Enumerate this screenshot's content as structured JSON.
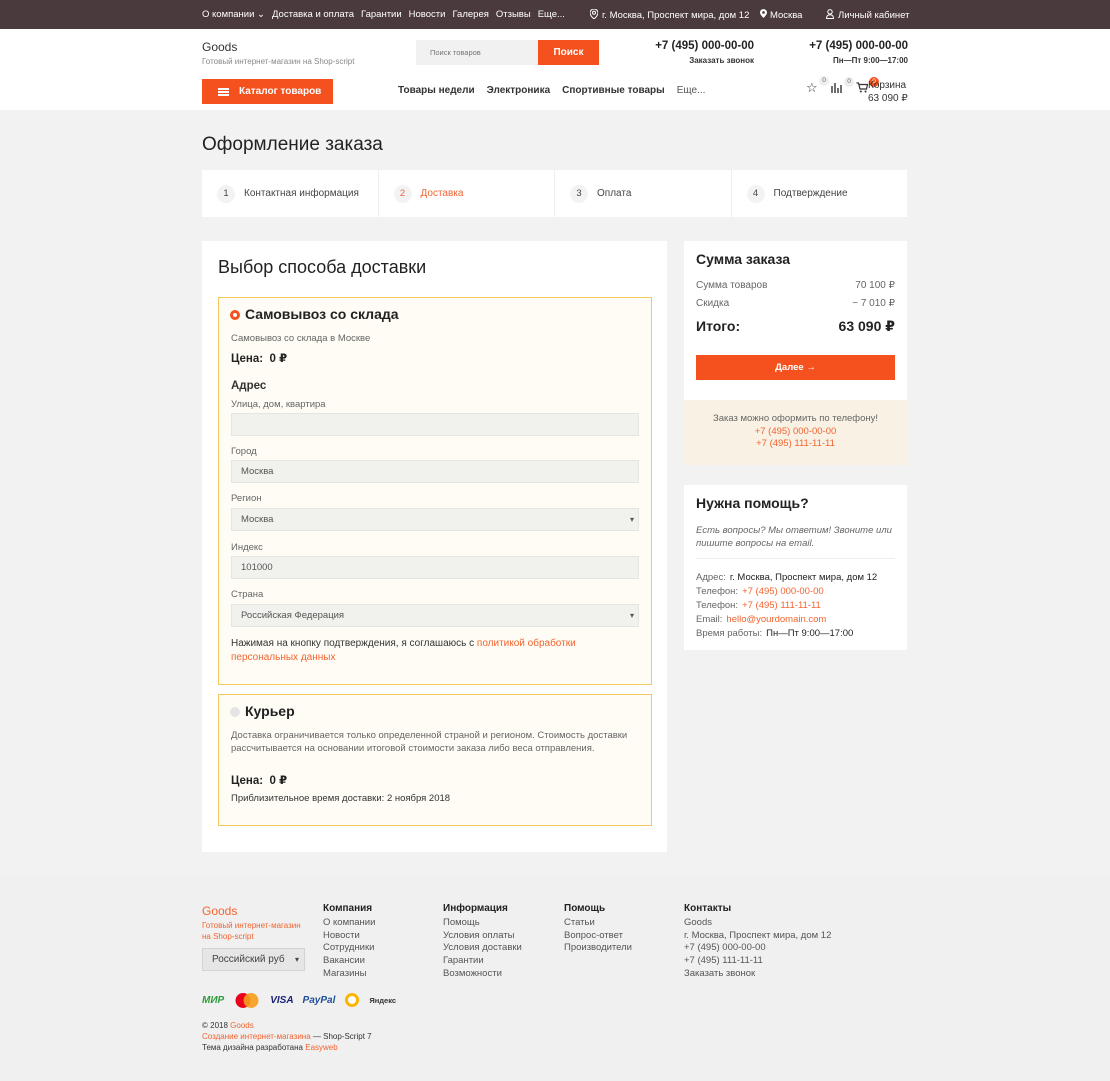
{
  "topbar": {
    "nav": [
      "О компании",
      "Доставка и оплата",
      "Гарантии",
      "Новости",
      "Галерея",
      "Отзывы",
      "Еще..."
    ],
    "address": "г. Москва, Проспект мира, дом 12",
    "city": "Москва",
    "cabinet": "Личный кабинет"
  },
  "header": {
    "logo": "Goods",
    "tagline": "Готовый интернет-магазин на Shop-script",
    "search_placeholder": "Поиск товаров",
    "search_button": "Поиск",
    "phone1": "+7 (495) 000-00-00",
    "phone1_sub": "Заказать звонок",
    "phone2": "+7 (495) 000-00-00",
    "phone2_sub": "Пн—Пт 9:00—17:00",
    "catalog_button": "Каталог товаров",
    "catnav": [
      "Товары недели",
      "Электроника",
      "Спортивные товары"
    ],
    "catnav_more": "Еще...",
    "favorites_count": "0",
    "compare_count": "0",
    "cart_count": "0",
    "cart_label": "Корзина",
    "cart_total": "63 090 ₽"
  },
  "checkout": {
    "title": "Оформление заказа",
    "steps": [
      {
        "num": "1",
        "label": "Контактная информация"
      },
      {
        "num": "2",
        "label": "Доставка"
      },
      {
        "num": "3",
        "label": "Оплата"
      },
      {
        "num": "4",
        "label": "Подтверждение"
      }
    ]
  },
  "delivery": {
    "title": "Выбор способа доставки",
    "pickup": {
      "title": "Самовывоз со склада",
      "desc": "Самовывоз со склада в Москве",
      "price_label": "Цена:",
      "price": "0 ₽",
      "address_heading": "Адрес",
      "street_label": "Улица, дом, квартира",
      "street_value": "",
      "city_label": "Город",
      "city_value": "Москва",
      "region_label": "Регион",
      "region_value": "Москва",
      "zip_label": "Индекс",
      "zip_value": "101000",
      "country_label": "Страна",
      "country_value": "Российская Федерация",
      "agree_text": "Нажимая на кнопку подтверждения, я соглашаюсь с ",
      "agree_link": "политикой обработки персональных данных"
    },
    "courier": {
      "title": "Курьер",
      "desc": "Доставка ограничивается только определенной страной и регионом. Стоимость доставки рассчитывается на основании итоговой стоимости заказа либо веса отправления.",
      "price_label": "Цена:",
      "price": "0 ₽",
      "time_label": "Приблизительное время доставки:",
      "time_value": "2 ноября 2018"
    }
  },
  "summary": {
    "title": "Сумма заказа",
    "items_label": "Сумма товаров",
    "items_value": "70 100 ₽",
    "discount_label": "Скидка",
    "discount_value": "− 7 010 ₽",
    "total_label": "Итого:",
    "total_value": "63 090 ₽",
    "next_button": "Далее →",
    "phone_note": "Заказ можно оформить по телефону!",
    "phone_a": "+7 (495) 000-00-00",
    "phone_b": "+7 (495) 111-11-11"
  },
  "help": {
    "title": "Нужна помощь?",
    "question": "Есть вопросы? Мы ответим! Звоните или пишите вопросы на email.",
    "address_label": "Адрес:",
    "address": "г. Москва, Проспект мира, дом 12",
    "phone_label": "Телефон:",
    "phone1": "+7 (495) 000-00-00",
    "phone2": "+7 (495) 111-11-11",
    "email_label": "Email:",
    "email": "hello@yourdomain.com",
    "hours_label": "Время работы:",
    "hours": "Пн—Пт 9:00—17:00"
  },
  "footer": {
    "logo": "Goods",
    "tagline": "Готовый интернет-магазин на Shop-script",
    "currency": "Российский руб",
    "cols": [
      {
        "title": "Компания",
        "items": [
          "О компании",
          "Новости",
          "Сотрудники",
          "Вакансии",
          "Магазины"
        ]
      },
      {
        "title": "Информация",
        "items": [
          "Помощь",
          "Условия оплаты",
          "Условия доставки",
          "Гарантии",
          "Возможности"
        ]
      },
      {
        "title": "Помощь",
        "items": [
          "Статьи",
          "Вопрос-ответ",
          "Производители"
        ]
      },
      {
        "title": "Контакты",
        "items": [
          "Goods",
          "г. Москва, Проспект мира, дом 12",
          "+7 (495) 000-00-00",
          "+7 (495) 111-11-11",
          "Заказать звонок"
        ]
      }
    ],
    "payments": [
      "МИР",
      "MasterCard",
      "VISA",
      "PayPal",
      "QIWI",
      "Яндекс"
    ],
    "copy_year": "© 2018",
    "copy_name": "Goods",
    "copy_link": "Создание интернет-магазина",
    "copy_rest": "— Shop-Script 7",
    "design_text": "Тема дизайна разработана",
    "design_link": "Easyweb"
  }
}
